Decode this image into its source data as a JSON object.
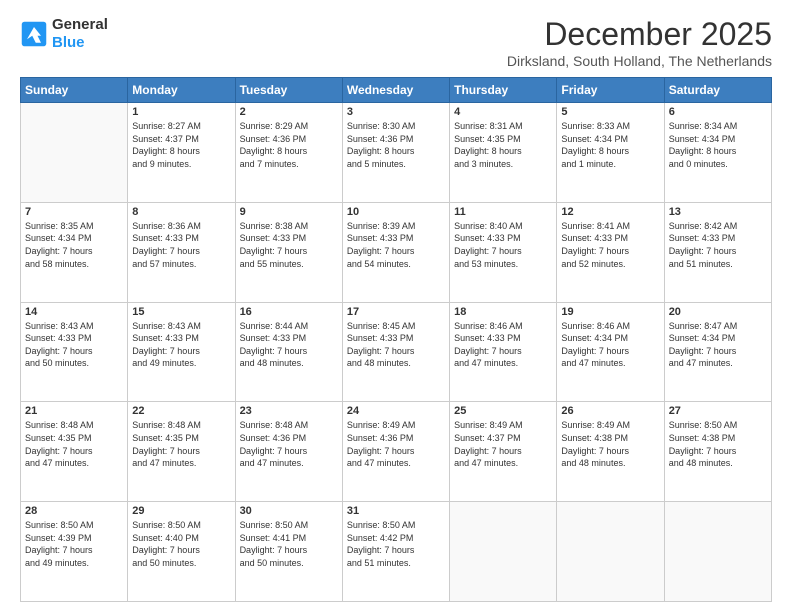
{
  "header": {
    "logo_line1": "General",
    "logo_line2": "Blue",
    "month_title": "December 2025",
    "location": "Dirksland, South Holland, The Netherlands"
  },
  "weekdays": [
    "Sunday",
    "Monday",
    "Tuesday",
    "Wednesday",
    "Thursday",
    "Friday",
    "Saturday"
  ],
  "weeks": [
    [
      {
        "day": "",
        "text": ""
      },
      {
        "day": "1",
        "text": "Sunrise: 8:27 AM\nSunset: 4:37 PM\nDaylight: 8 hours\nand 9 minutes."
      },
      {
        "day": "2",
        "text": "Sunrise: 8:29 AM\nSunset: 4:36 PM\nDaylight: 8 hours\nand 7 minutes."
      },
      {
        "day": "3",
        "text": "Sunrise: 8:30 AM\nSunset: 4:36 PM\nDaylight: 8 hours\nand 5 minutes."
      },
      {
        "day": "4",
        "text": "Sunrise: 8:31 AM\nSunset: 4:35 PM\nDaylight: 8 hours\nand 3 minutes."
      },
      {
        "day": "5",
        "text": "Sunrise: 8:33 AM\nSunset: 4:34 PM\nDaylight: 8 hours\nand 1 minute."
      },
      {
        "day": "6",
        "text": "Sunrise: 8:34 AM\nSunset: 4:34 PM\nDaylight: 8 hours\nand 0 minutes."
      }
    ],
    [
      {
        "day": "7",
        "text": "Sunrise: 8:35 AM\nSunset: 4:34 PM\nDaylight: 7 hours\nand 58 minutes."
      },
      {
        "day": "8",
        "text": "Sunrise: 8:36 AM\nSunset: 4:33 PM\nDaylight: 7 hours\nand 57 minutes."
      },
      {
        "day": "9",
        "text": "Sunrise: 8:38 AM\nSunset: 4:33 PM\nDaylight: 7 hours\nand 55 minutes."
      },
      {
        "day": "10",
        "text": "Sunrise: 8:39 AM\nSunset: 4:33 PM\nDaylight: 7 hours\nand 54 minutes."
      },
      {
        "day": "11",
        "text": "Sunrise: 8:40 AM\nSunset: 4:33 PM\nDaylight: 7 hours\nand 53 minutes."
      },
      {
        "day": "12",
        "text": "Sunrise: 8:41 AM\nSunset: 4:33 PM\nDaylight: 7 hours\nand 52 minutes."
      },
      {
        "day": "13",
        "text": "Sunrise: 8:42 AM\nSunset: 4:33 PM\nDaylight: 7 hours\nand 51 minutes."
      }
    ],
    [
      {
        "day": "14",
        "text": "Sunrise: 8:43 AM\nSunset: 4:33 PM\nDaylight: 7 hours\nand 50 minutes."
      },
      {
        "day": "15",
        "text": "Sunrise: 8:43 AM\nSunset: 4:33 PM\nDaylight: 7 hours\nand 49 minutes."
      },
      {
        "day": "16",
        "text": "Sunrise: 8:44 AM\nSunset: 4:33 PM\nDaylight: 7 hours\nand 48 minutes."
      },
      {
        "day": "17",
        "text": "Sunrise: 8:45 AM\nSunset: 4:33 PM\nDaylight: 7 hours\nand 48 minutes."
      },
      {
        "day": "18",
        "text": "Sunrise: 8:46 AM\nSunset: 4:33 PM\nDaylight: 7 hours\nand 47 minutes."
      },
      {
        "day": "19",
        "text": "Sunrise: 8:46 AM\nSunset: 4:34 PM\nDaylight: 7 hours\nand 47 minutes."
      },
      {
        "day": "20",
        "text": "Sunrise: 8:47 AM\nSunset: 4:34 PM\nDaylight: 7 hours\nand 47 minutes."
      }
    ],
    [
      {
        "day": "21",
        "text": "Sunrise: 8:48 AM\nSunset: 4:35 PM\nDaylight: 7 hours\nand 47 minutes."
      },
      {
        "day": "22",
        "text": "Sunrise: 8:48 AM\nSunset: 4:35 PM\nDaylight: 7 hours\nand 47 minutes."
      },
      {
        "day": "23",
        "text": "Sunrise: 8:48 AM\nSunset: 4:36 PM\nDaylight: 7 hours\nand 47 minutes."
      },
      {
        "day": "24",
        "text": "Sunrise: 8:49 AM\nSunset: 4:36 PM\nDaylight: 7 hours\nand 47 minutes."
      },
      {
        "day": "25",
        "text": "Sunrise: 8:49 AM\nSunset: 4:37 PM\nDaylight: 7 hours\nand 47 minutes."
      },
      {
        "day": "26",
        "text": "Sunrise: 8:49 AM\nSunset: 4:38 PM\nDaylight: 7 hours\nand 48 minutes."
      },
      {
        "day": "27",
        "text": "Sunrise: 8:50 AM\nSunset: 4:38 PM\nDaylight: 7 hours\nand 48 minutes."
      }
    ],
    [
      {
        "day": "28",
        "text": "Sunrise: 8:50 AM\nSunset: 4:39 PM\nDaylight: 7 hours\nand 49 minutes."
      },
      {
        "day": "29",
        "text": "Sunrise: 8:50 AM\nSunset: 4:40 PM\nDaylight: 7 hours\nand 50 minutes."
      },
      {
        "day": "30",
        "text": "Sunrise: 8:50 AM\nSunset: 4:41 PM\nDaylight: 7 hours\nand 50 minutes."
      },
      {
        "day": "31",
        "text": "Sunrise: 8:50 AM\nSunset: 4:42 PM\nDaylight: 7 hours\nand 51 minutes."
      },
      {
        "day": "",
        "text": ""
      },
      {
        "day": "",
        "text": ""
      },
      {
        "day": "",
        "text": ""
      }
    ]
  ]
}
